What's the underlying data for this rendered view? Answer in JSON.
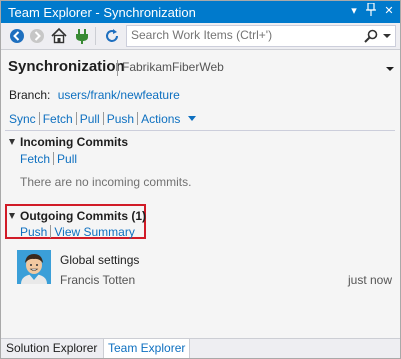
{
  "window": {
    "title": "Team Explorer - Synchronization",
    "title_controls": {
      "dropdown": "▾",
      "pin": "⨨",
      "close": "✕"
    }
  },
  "toolbar": {
    "search_placeholder": "Search Work Items (Ctrl+')"
  },
  "page": {
    "title": "Synchronization",
    "project": "FabrikamFiberWeb"
  },
  "branch": {
    "label": "Branch:",
    "name": "users/frank/newfeature"
  },
  "actions": [
    "Sync",
    "Fetch",
    "Pull",
    "Push",
    "Actions"
  ],
  "incoming": {
    "heading": "Incoming Commits",
    "links": [
      "Fetch",
      "Pull"
    ],
    "empty_text": "There are no incoming commits."
  },
  "outgoing": {
    "heading": "Outgoing Commits (1)",
    "links": [
      "Push",
      "View Summary"
    ],
    "commits": [
      {
        "message": "Global settings",
        "author": "Francis Totten",
        "time": "just now"
      }
    ]
  },
  "tabs": [
    {
      "label": "Solution Explorer",
      "active": false
    },
    {
      "label": "Team Explorer",
      "active": true
    }
  ],
  "colors": {
    "accent": "#007acc",
    "link": "#0e70c0",
    "highlight_border": "#d11b27"
  }
}
